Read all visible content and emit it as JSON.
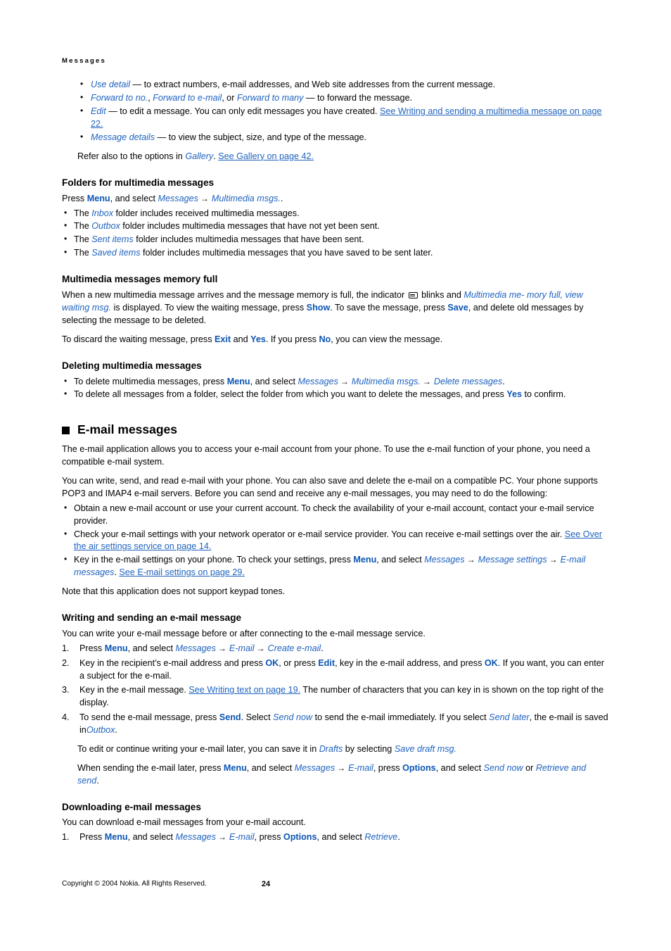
{
  "page": {
    "running_head": "Messages",
    "page_number": "24",
    "copyright": "Copyright © 2004 Nokia. All Rights Reserved.",
    "arrow_glyph": "→",
    "square_bullet": "■",
    "colors": {
      "link": "#1f63bf",
      "bold_key": "#0b55b3",
      "italic_term": "#1f63bf",
      "text": "#000000",
      "background": "#ffffff"
    }
  },
  "top_bullets": [
    {
      "parts": [
        {
          "t": "ital",
          "v": "Use detail"
        },
        {
          "t": "plain",
          "v": " — to extract numbers, e-mail addresses, and Web site addresses from the current message."
        }
      ]
    },
    {
      "parts": [
        {
          "t": "ital",
          "v": "Forward to no."
        },
        {
          "t": "plain",
          "v": ", "
        },
        {
          "t": "ital",
          "v": "Forward to e-mail"
        },
        {
          "t": "plain",
          "v": ", or "
        },
        {
          "t": "ital",
          "v": "Forward to many"
        },
        {
          "t": "plain",
          "v": " — to forward the message."
        }
      ]
    },
    {
      "parts": [
        {
          "t": "ital",
          "v": "Edit"
        },
        {
          "t": "plain",
          "v": " — to edit a message. You can only edit messages you have created. "
        },
        {
          "t": "link",
          "v": "See Writing and sending a multimedia message on page 22."
        }
      ]
    },
    {
      "parts": [
        {
          "t": "ital",
          "v": "Message details"
        },
        {
          "t": "plain",
          "v": " —  to view the subject, size, and type of the message."
        }
      ]
    }
  ],
  "refer_also": {
    "parts": [
      {
        "t": "plain",
        "v": "Refer also to the options in "
      },
      {
        "t": "ital",
        "v": "Gallery"
      },
      {
        "t": "plain",
        "v": ". "
      },
      {
        "t": "link",
        "v": "See Gallery on page 42."
      }
    ]
  },
  "folders_section": {
    "heading": "Folders for multimedia messages",
    "intro": {
      "parts": [
        {
          "t": "plain",
          "v": "Press "
        },
        {
          "t": "bold",
          "v": "Menu"
        },
        {
          "t": "plain",
          "v": ", and select "
        },
        {
          "t": "ital",
          "v": "Messages"
        },
        {
          "t": "arrow",
          "v": "→"
        },
        {
          "t": "ital",
          "v": "Multimedia msgs."
        },
        {
          "t": "plain",
          "v": "."
        }
      ]
    },
    "bullets": [
      {
        "parts": [
          {
            "t": "plain",
            "v": "The "
          },
          {
            "t": "ital",
            "v": "Inbox"
          },
          {
            "t": "plain",
            "v": " folder includes received multimedia messages."
          }
        ]
      },
      {
        "parts": [
          {
            "t": "plain",
            "v": "The "
          },
          {
            "t": "ital",
            "v": "Outbox"
          },
          {
            "t": "plain",
            "v": " folder includes multimedia messages that have not yet been sent."
          }
        ]
      },
      {
        "parts": [
          {
            "t": "plain",
            "v": "The "
          },
          {
            "t": "ital",
            "v": "Sent items"
          },
          {
            "t": "plain",
            "v": " folder includes multimedia messages that have been sent."
          }
        ]
      },
      {
        "parts": [
          {
            "t": "plain",
            "v": "The "
          },
          {
            "t": "ital",
            "v": "Saved items"
          },
          {
            "t": "plain",
            "v": " folder includes multimedia messages that you have saved to be sent later."
          }
        ]
      }
    ]
  },
  "memory_full_section": {
    "heading": "Multimedia messages memory full",
    "para1": {
      "parts": [
        {
          "t": "plain",
          "v": "When a new multimedia message arrives and the message memory is full, the indicator "
        },
        {
          "t": "icon",
          "v": "envelope-icon"
        },
        {
          "t": "plain",
          "v": " blinks and "
        },
        {
          "t": "ital",
          "v": "Multimedia me- mory full, view waiting msg."
        },
        {
          "t": "plain",
          "v": " is displayed. To view the waiting message, press "
        },
        {
          "t": "bold",
          "v": "Show"
        },
        {
          "t": "plain",
          "v": ". To save the message, press "
        },
        {
          "t": "bold",
          "v": "Save"
        },
        {
          "t": "plain",
          "v": ", and delete old messages by selecting the message to be deleted."
        }
      ]
    },
    "para2": {
      "parts": [
        {
          "t": "plain",
          "v": "To discard the waiting message, press "
        },
        {
          "t": "bold",
          "v": "Exit"
        },
        {
          "t": "plain",
          "v": " and "
        },
        {
          "t": "bold",
          "v": "Yes"
        },
        {
          "t": "plain",
          "v": ". If you press "
        },
        {
          "t": "bold",
          "v": "No"
        },
        {
          "t": "plain",
          "v": ", you can view the message."
        }
      ]
    }
  },
  "deleting_section": {
    "heading": "Deleting multimedia messages",
    "bullets": [
      {
        "parts": [
          {
            "t": "plain",
            "v": "To delete multimedia messages, press "
          },
          {
            "t": "bold",
            "v": "Menu"
          },
          {
            "t": "plain",
            "v": ", and select "
          },
          {
            "t": "ital",
            "v": "Messages"
          },
          {
            "t": "arrow",
            "v": "→"
          },
          {
            "t": "ital",
            "v": "Multimedia msgs."
          },
          {
            "t": "arrow",
            "v": "→"
          },
          {
            "t": "ital",
            "v": "Delete messages"
          },
          {
            "t": "plain",
            "v": "."
          }
        ]
      },
      {
        "parts": [
          {
            "t": "plain",
            "v": "To delete all messages from a folder, select the folder from which you want to delete the messages, and press "
          },
          {
            "t": "bold",
            "v": "Yes"
          },
          {
            "t": "plain",
            "v": " to confirm."
          }
        ]
      }
    ]
  },
  "email_section": {
    "heading": "E-mail messages",
    "para1": {
      "parts": [
        {
          "t": "plain",
          "v": "The e-mail application allows you to access your e-mail account from your phone. To use the e-mail function of your phone, you need a compatible e-mail system."
        }
      ]
    },
    "para2": {
      "parts": [
        {
          "t": "plain",
          "v": "You can write, send, and read e-mail with your phone. You can also save and delete the e-mail on a compatible PC. Your phone supports POP3 and IMAP4 e-mail servers. Before you can send and receive any e-mail messages, you may need to do the following:"
        }
      ]
    },
    "bullets": [
      {
        "parts": [
          {
            "t": "plain",
            "v": "Obtain a new e-mail account or use your current account. To check the availability of your e-mail account, contact your e-mail service provider."
          }
        ]
      },
      {
        "parts": [
          {
            "t": "plain",
            "v": "Check your e-mail settings with your network operator or e-mail service provider. You can receive e-mail settings over the air. "
          },
          {
            "t": "link",
            "v": "See Over the air settings service on page 14."
          }
        ]
      },
      {
        "parts": [
          {
            "t": "plain",
            "v": "Key in the e-mail settings on your phone. To check your settings, press "
          },
          {
            "t": "bold",
            "v": "Menu"
          },
          {
            "t": "plain",
            "v": ", and select "
          },
          {
            "t": "ital",
            "v": "Messages"
          },
          {
            "t": "arrow",
            "v": "→"
          },
          {
            "t": "ital",
            "v": "Message settings"
          },
          {
            "t": "arrow",
            "v": "→"
          },
          {
            "t": "ital",
            "v": "E-mail messages"
          },
          {
            "t": "plain",
            "v": ". "
          },
          {
            "t": "link",
            "v": "See E-mail settings on page 29."
          }
        ]
      }
    ],
    "note": {
      "parts": [
        {
          "t": "plain",
          "v": "Note that this application does not support keypad tones."
        }
      ]
    }
  },
  "writing_section": {
    "heading": "Writing and sending an e-mail message",
    "intro": {
      "parts": [
        {
          "t": "plain",
          "v": "You can write your e-mail message before or after connecting to the e-mail message service."
        }
      ]
    },
    "steps": [
      {
        "parts": [
          {
            "t": "plain",
            "v": "Press "
          },
          {
            "t": "bold",
            "v": "Menu"
          },
          {
            "t": "plain",
            "v": ", and select "
          },
          {
            "t": "ital",
            "v": "Messages"
          },
          {
            "t": "arrow",
            "v": "→"
          },
          {
            "t": "ital",
            "v": "E-mail"
          },
          {
            "t": "arrow",
            "v": "→"
          },
          {
            "t": "ital",
            "v": "Create e-mail"
          },
          {
            "t": "plain",
            "v": "."
          }
        ]
      },
      {
        "parts": [
          {
            "t": "plain",
            "v": "Key in the recipient’s e-mail address and press "
          },
          {
            "t": "bold",
            "v": "OK"
          },
          {
            "t": "plain",
            "v": ", or press "
          },
          {
            "t": "bold",
            "v": "Edit"
          },
          {
            "t": "plain",
            "v": ", key in the e-mail address, and press "
          },
          {
            "t": "bold",
            "v": "OK"
          },
          {
            "t": "plain",
            "v": ". If you want, you can enter a subject for the e-mail."
          }
        ]
      },
      {
        "parts": [
          {
            "t": "plain",
            "v": "Key in the e-mail message. "
          },
          {
            "t": "link",
            "v": "See Writing text on page 19."
          },
          {
            "t": "plain",
            "v": " The number of characters that you can key in is shown on the top right of the display."
          }
        ]
      },
      {
        "parts": [
          {
            "t": "plain",
            "v": "To send the e-mail message, press "
          },
          {
            "t": "bold",
            "v": "Send"
          },
          {
            "t": "plain",
            "v": ". Select "
          },
          {
            "t": "ital",
            "v": "Send now"
          },
          {
            "t": "plain",
            "v": " to send the e-mail immediately. If you select "
          },
          {
            "t": "ital",
            "v": "Send later"
          },
          {
            "t": "plain",
            "v": ", the e-mail is saved in"
          },
          {
            "t": "ital",
            "v": "Outbox"
          },
          {
            "t": "plain",
            "v": "."
          }
        ]
      }
    ],
    "after_step4": [
      {
        "parts": [
          {
            "t": "plain",
            "v": "To edit or continue writing your e-mail later, you can save it in "
          },
          {
            "t": "ital",
            "v": "Drafts"
          },
          {
            "t": "plain",
            "v": " by selecting "
          },
          {
            "t": "ital",
            "v": "Save draft msg."
          }
        ]
      },
      {
        "parts": [
          {
            "t": "plain",
            "v": "When sending the e-mail later, press "
          },
          {
            "t": "bold",
            "v": "Menu"
          },
          {
            "t": "plain",
            "v": ", and select "
          },
          {
            "t": "ital",
            "v": "Messages"
          },
          {
            "t": "arrow",
            "v": "→"
          },
          {
            "t": "ital",
            "v": "E-mail"
          },
          {
            "t": "plain",
            "v": ", press "
          },
          {
            "t": "bold",
            "v": "Options"
          },
          {
            "t": "plain",
            "v": ", and select "
          },
          {
            "t": "ital",
            "v": "Send now"
          },
          {
            "t": "plain",
            "v": " or "
          },
          {
            "t": "ital",
            "v": "Retrieve and send"
          },
          {
            "t": "plain",
            "v": "."
          }
        ]
      }
    ]
  },
  "downloading_section": {
    "heading": "Downloading e-mail messages",
    "intro": {
      "parts": [
        {
          "t": "plain",
          "v": "You can download e-mail messages from your e-mail account."
        }
      ]
    },
    "steps": [
      {
        "parts": [
          {
            "t": "plain",
            "v": "Press "
          },
          {
            "t": "bold",
            "v": "Menu"
          },
          {
            "t": "plain",
            "v": ", and select "
          },
          {
            "t": "ital",
            "v": "Messages"
          },
          {
            "t": "arrow",
            "v": "→"
          },
          {
            "t": "ital",
            "v": "E-mail"
          },
          {
            "t": "plain",
            "v": ", press "
          },
          {
            "t": "bold",
            "v": "Options"
          },
          {
            "t": "plain",
            "v": ", and select "
          },
          {
            "t": "ital",
            "v": "Retrieve"
          },
          {
            "t": "plain",
            "v": "."
          }
        ]
      }
    ]
  }
}
